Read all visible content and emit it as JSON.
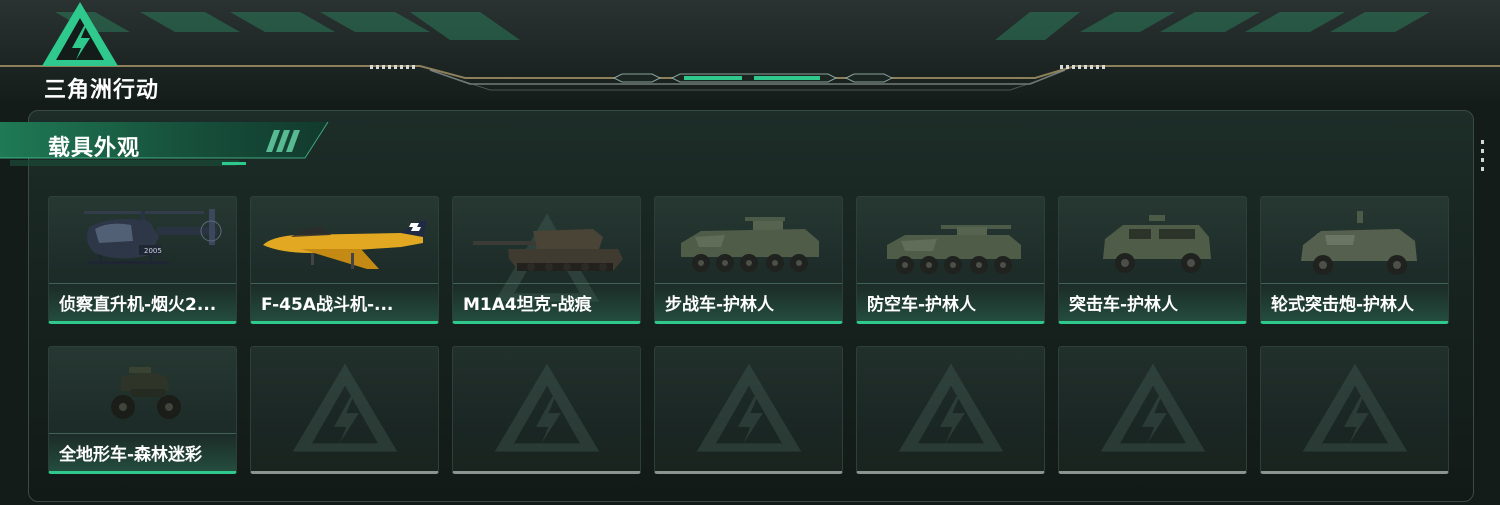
{
  "game": {
    "logo_text": "三角洲行动",
    "accent": "#2fc98d"
  },
  "section": {
    "title": "载具外观"
  },
  "vehicles": [
    {
      "label": "侦察直升机-烟火2...",
      "icon": "helicopter-icon"
    },
    {
      "label": "F-45A战斗机-...",
      "icon": "fighter-jet-icon"
    },
    {
      "label": "M1A4坦克-战痕",
      "icon": "tank-icon"
    },
    {
      "label": "步战车-护林人",
      "icon": "ifv-icon"
    },
    {
      "label": "防空车-护林人",
      "icon": "aa-vehicle-icon"
    },
    {
      "label": "突击车-护林人",
      "icon": "assault-vehicle-icon"
    },
    {
      "label": "轮式突击炮-护林人",
      "icon": "wheeled-assault-gun-icon"
    },
    {
      "label": "全地形车-森林迷彩",
      "icon": "atv-icon"
    }
  ],
  "empty_slots": 6
}
